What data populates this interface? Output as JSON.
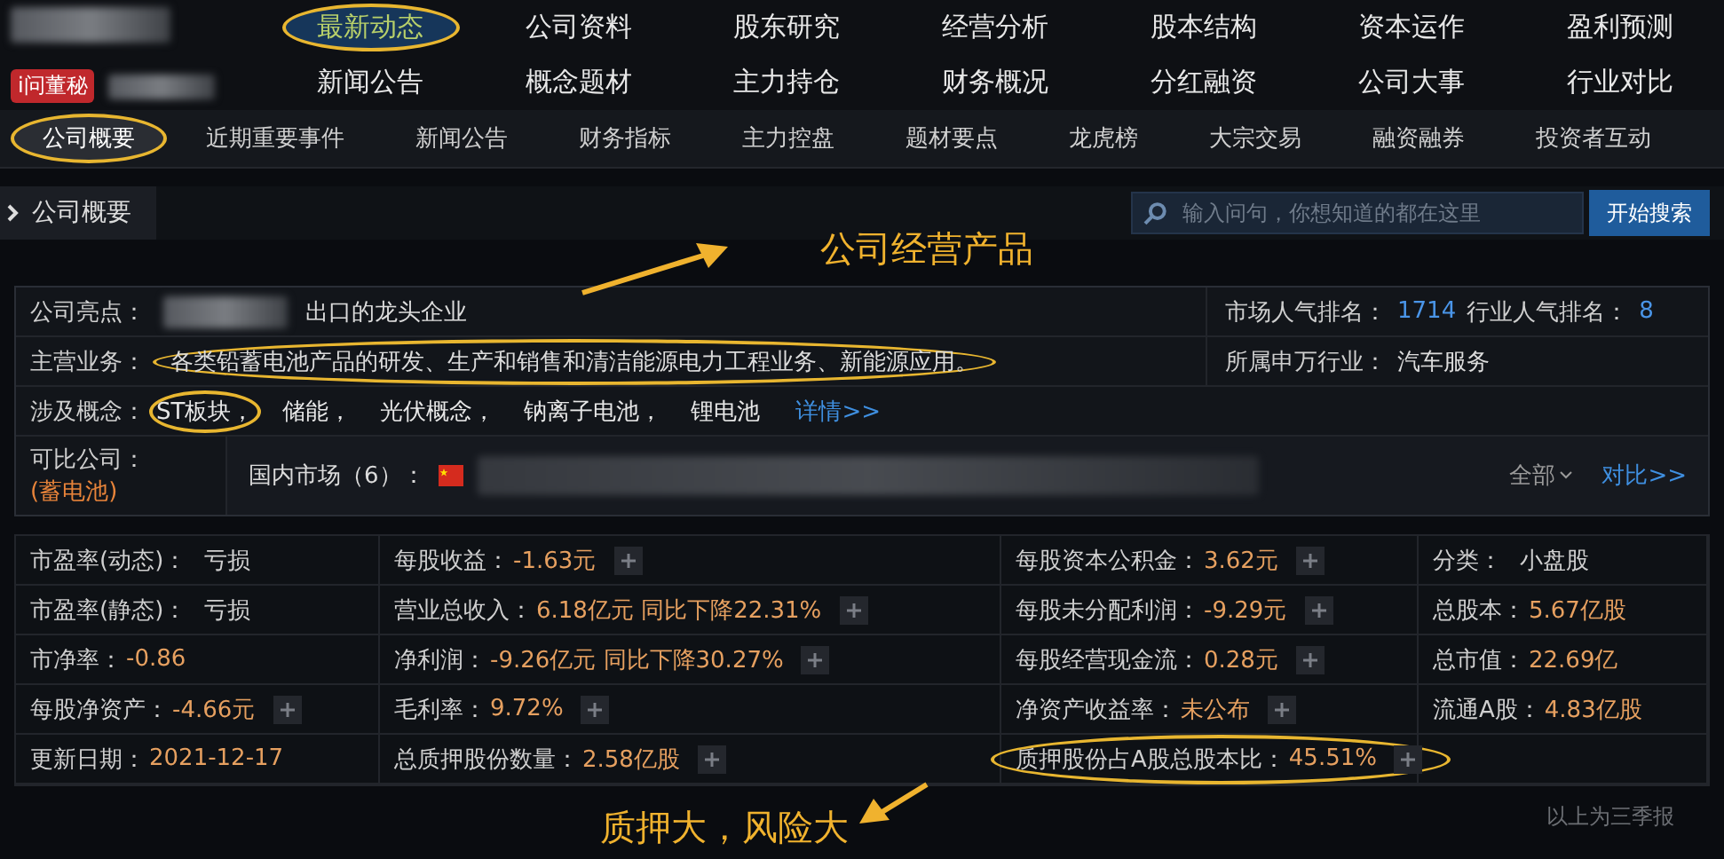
{
  "header": {
    "badge": "i问董秘",
    "nav": [
      {
        "label": "最新动态",
        "selected": true,
        "circled": true
      },
      {
        "label": "公司资料",
        "selected": false,
        "circled": false
      },
      {
        "label": "股东研究",
        "selected": false,
        "circled": false
      },
      {
        "label": "经营分析",
        "selected": false,
        "circled": false
      },
      {
        "label": "股本结构",
        "selected": false,
        "circled": false
      },
      {
        "label": "资本运作",
        "selected": false,
        "circled": false
      },
      {
        "label": "盈利预测",
        "selected": false,
        "circled": false
      },
      {
        "label": "新闻公告",
        "selected": false,
        "circled": false
      },
      {
        "label": "概念题材",
        "selected": false,
        "circled": false
      },
      {
        "label": "主力持仓",
        "selected": false,
        "circled": false
      },
      {
        "label": "财务概况",
        "selected": false,
        "circled": false
      },
      {
        "label": "分红融资",
        "selected": false,
        "circled": false
      },
      {
        "label": "公司大事",
        "selected": false,
        "circled": false
      },
      {
        "label": "行业对比",
        "selected": false,
        "circled": false
      }
    ]
  },
  "subnav": [
    {
      "label": "公司概要",
      "selected": true,
      "circled": true
    },
    {
      "label": "近期重要事件",
      "selected": false,
      "circled": false
    },
    {
      "label": "新闻公告",
      "selected": false,
      "circled": false
    },
    {
      "label": "财务指标",
      "selected": false,
      "circled": false
    },
    {
      "label": "主力控盘",
      "selected": false,
      "circled": false
    },
    {
      "label": "题材要点",
      "selected": false,
      "circled": false
    },
    {
      "label": "龙虎榜",
      "selected": false,
      "circled": false
    },
    {
      "label": "大宗交易",
      "selected": false,
      "circled": false
    },
    {
      "label": "融资融券",
      "selected": false,
      "circled": false
    },
    {
      "label": "投资者互动",
      "selected": false,
      "circled": false
    }
  ],
  "section": {
    "title": "公司概要",
    "search": {
      "placeholder": "输入问句，你想知道的都在这里"
    },
    "search_button": "开始搜索"
  },
  "overview": {
    "highlight": {
      "label": "公司亮点：",
      "value": "出口的龙头企业"
    },
    "business": {
      "label": "主营业务：",
      "value": "各类铅蓄电池产品的研发、生产和销售和清洁能源电力工程业务、新能源应用。",
      "circled": true
    },
    "concepts": {
      "label": "涉及概念：",
      "items": [
        {
          "text": "ST板块，",
          "circled": true
        },
        {
          "text": "储能，",
          "circled": false
        },
        {
          "text": "光伏概念，",
          "circled": false
        },
        {
          "text": "钠离子电池，",
          "circled": false
        },
        {
          "text": "锂电池",
          "circled": false
        }
      ],
      "link": "详情>>"
    },
    "comparable": {
      "label": "可比公司：",
      "category": "(蓄电池)",
      "market": "国内市场（6）：",
      "filter": "全部",
      "link": "对比>>"
    },
    "popularity": [
      {
        "label": "市场人气排名：",
        "value": "1714"
      },
      {
        "label": "行业人气排名：",
        "value": "8"
      }
    ],
    "industry": {
      "label": "所属申万行业：",
      "value": "汽车服务"
    }
  },
  "metrics": [
    [
      {
        "label": "市盈率(动态)：",
        "value": "亏损",
        "kind": "plain",
        "plus": false,
        "circled": false
      },
      {
        "label": "每股收益：",
        "value": "-1.63元",
        "kind": "accent",
        "plus": true,
        "circled": false
      },
      {
        "label": "每股资本公积金：",
        "value": "3.62元",
        "kind": "accent",
        "plus": true,
        "circled": false
      },
      {
        "label": "分类：",
        "value": "小盘股",
        "kind": "plain",
        "plus": false,
        "circled": false
      }
    ],
    [
      {
        "label": "市盈率(静态)：",
        "value": "亏损",
        "kind": "plain",
        "plus": false,
        "circled": false
      },
      {
        "label": "营业总收入：",
        "value": "6.18亿元 同比下降22.31%",
        "kind": "accent",
        "plus": true,
        "circled": false
      },
      {
        "label": "每股未分配利润：",
        "value": "-9.29元",
        "kind": "accent",
        "plus": true,
        "circled": false
      },
      {
        "label": "总股本：",
        "value": "5.67亿股",
        "kind": "accent",
        "plus": false,
        "circled": false
      }
    ],
    [
      {
        "label": "市净率：",
        "value": "-0.86",
        "kind": "accent",
        "plus": false,
        "circled": false
      },
      {
        "label": "净利润：",
        "value": "-9.26亿元 同比下降30.27%",
        "kind": "accent",
        "plus": true,
        "circled": false
      },
      {
        "label": "每股经营现金流：",
        "value": "0.28元",
        "kind": "accent",
        "plus": true,
        "circled": false
      },
      {
        "label": "总市值：",
        "value": "22.69亿",
        "kind": "accent",
        "plus": false,
        "circled": false
      }
    ],
    [
      {
        "label": "每股净资产：",
        "value": "-4.66元",
        "kind": "accent",
        "plus": true,
        "circled": false
      },
      {
        "label": "毛利率：",
        "value": "9.72%",
        "kind": "accent",
        "plus": true,
        "circled": false
      },
      {
        "label": "净资产收益率：",
        "value": "未公布",
        "kind": "accent",
        "plus": true,
        "circled": false
      },
      {
        "label": "流通A股：",
        "value": "4.83亿股",
        "kind": "accent",
        "plus": false,
        "circled": false
      }
    ],
    [
      {
        "label": "更新日期：",
        "value": "2021-12-17",
        "kind": "accent",
        "plus": false,
        "circled": false
      },
      {
        "label": "总质押股份数量：",
        "value": "2.58亿股",
        "kind": "accent",
        "plus": true,
        "circled": false
      },
      {
        "label": "质押股份占A股总股本比：",
        "value": "45.51%",
        "kind": "accent",
        "plus": true,
        "circled": true
      }
    ]
  ],
  "footnote": "以上为三季报",
  "annotations": [
    {
      "kind": "top",
      "text": "公司经营产品"
    },
    {
      "kind": "bottom",
      "text": "质押大，风险大"
    }
  ]
}
